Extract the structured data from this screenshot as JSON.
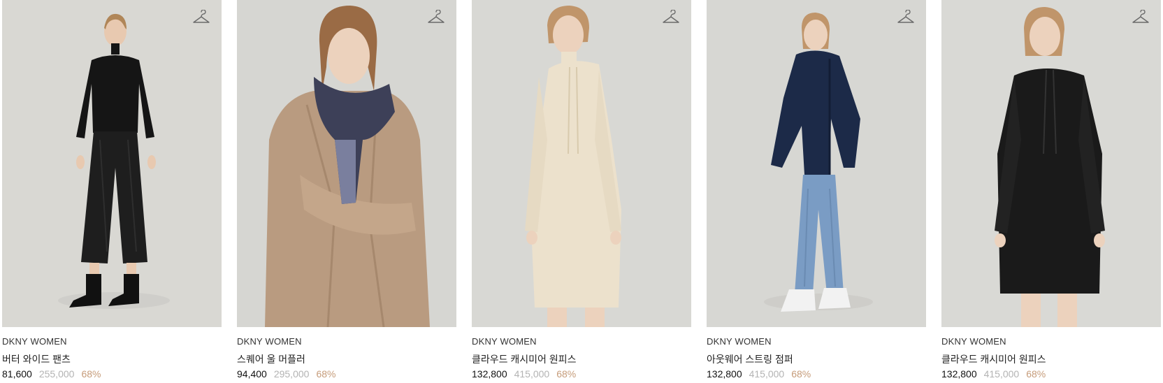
{
  "products": [
    {
      "brand": "DKNY WOMEN",
      "name": "버터 와이드 팬츠",
      "sale_price": "81,600",
      "original_price": "255,000",
      "discount": "68%",
      "wishlist_icon": "hanger-icon",
      "bg": "#d9d8d3",
      "garment": "#151515",
      "garment2": "#1e1e1e"
    },
    {
      "brand": "DKNY WOMEN",
      "name": "스퀘어 울 머플러",
      "sale_price": "94,400",
      "original_price": "295,000",
      "discount": "68%",
      "wishlist_icon": "hanger-icon",
      "bg": "#d6d6d2",
      "garment": "#b99b80",
      "garment2": "#3d4058"
    },
    {
      "brand": "DKNY WOMEN",
      "name": "클라우드 캐시미어 원피스",
      "sale_price": "132,800",
      "original_price": "415,000",
      "discount": "68%",
      "wishlist_icon": "hanger-icon",
      "bg": "#d8d8d4",
      "garment": "#ece1cc",
      "garment2": "#ece1cc"
    },
    {
      "brand": "DKNY WOMEN",
      "name": "아웃웨어 스트링 점퍼",
      "sale_price": "132,800",
      "original_price": "415,000",
      "discount": "68%",
      "wishlist_icon": "hanger-icon",
      "bg": "#d7d7d3",
      "garment": "#1c2a48",
      "garment2": "#7a9cc4"
    },
    {
      "brand": "DKNY WOMEN",
      "name": "클라우드 캐시미어 원피스",
      "sale_price": "132,800",
      "original_price": "415,000",
      "discount": "68%",
      "wishlist_icon": "hanger-icon",
      "bg": "#d9d9d5",
      "garment": "#1a1a1a",
      "garment2": "#1a1a1a"
    }
  ]
}
